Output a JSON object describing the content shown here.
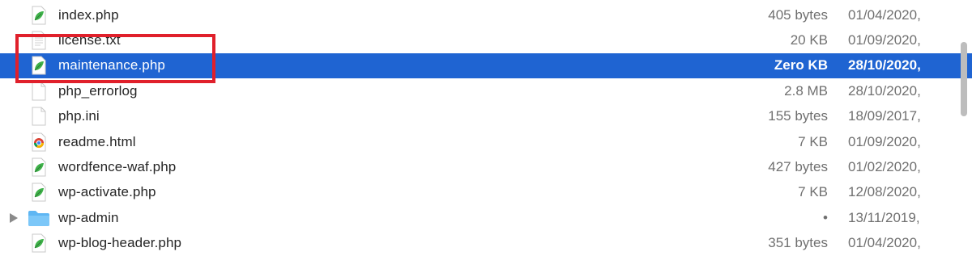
{
  "colors": {
    "selection": "#1f64d2",
    "annotation_box": "#e0202b",
    "secondary_text": "#707070",
    "php_leaf": "#3fb24a",
    "folder": "#5eb6f3"
  },
  "files": [
    {
      "name": "index.php",
      "size": "405 bytes",
      "date": "01/04/2020,",
      "icon": "php-file-icon",
      "selected": false,
      "disclosure": false
    },
    {
      "name": "license.txt",
      "size": "20 KB",
      "date": "01/09/2020,",
      "icon": "text-file-icon",
      "selected": false,
      "disclosure": false
    },
    {
      "name": "maintenance.php",
      "size": "Zero KB",
      "date": "28/10/2020,",
      "icon": "php-file-icon",
      "selected": true,
      "disclosure": false
    },
    {
      "name": "php_errorlog",
      "size": "2.8 MB",
      "date": "28/10/2020,",
      "icon": "blank-file-icon",
      "selected": false,
      "disclosure": false
    },
    {
      "name": "php.ini",
      "size": "155 bytes",
      "date": "18/09/2017,",
      "icon": "blank-file-icon",
      "selected": false,
      "disclosure": false
    },
    {
      "name": "readme.html",
      "size": "7 KB",
      "date": "01/09/2020,",
      "icon": "html-file-icon",
      "selected": false,
      "disclosure": false
    },
    {
      "name": "wordfence-waf.php",
      "size": "427 bytes",
      "date": "01/02/2020,",
      "icon": "php-file-icon",
      "selected": false,
      "disclosure": false
    },
    {
      "name": "wp-activate.php",
      "size": "7 KB",
      "date": "12/08/2020,",
      "icon": "php-file-icon",
      "selected": false,
      "disclosure": false
    },
    {
      "name": "wp-admin",
      "size": "•",
      "date": "13/11/2019,",
      "icon": "folder-icon",
      "selected": false,
      "disclosure": true
    },
    {
      "name": "wp-blog-header.php",
      "size": "351 bytes",
      "date": "01/04/2020,",
      "icon": "php-file-icon",
      "selected": false,
      "disclosure": false
    }
  ]
}
